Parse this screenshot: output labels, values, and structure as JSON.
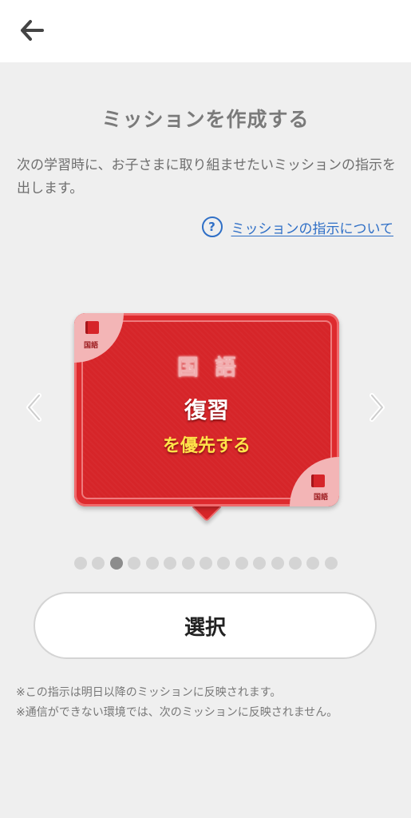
{
  "header": {
    "back_icon": "arrow-left-icon"
  },
  "page_title": "ミッションを作成する",
  "description": "次の学習時に、お子さまに取り組ませたいミッションの指示を出します。",
  "help_link": {
    "icon": "question-circle-icon",
    "label": "ミッションの指示について"
  },
  "carousel": {
    "prev_icon": "chevron-left-icon",
    "next_icon": "chevron-right-icon",
    "card": {
      "subject": "国語",
      "corner_label": "国語",
      "mission": "復習",
      "mission_sub": "を優先する",
      "color": "#de2a2e"
    },
    "page_count": 15,
    "active_index": 2
  },
  "select_button": "選択",
  "notes": [
    "※この指示は明日以降のミッションに反映されます。",
    "※通信ができない環境では、次のミッションに反映されません。"
  ]
}
